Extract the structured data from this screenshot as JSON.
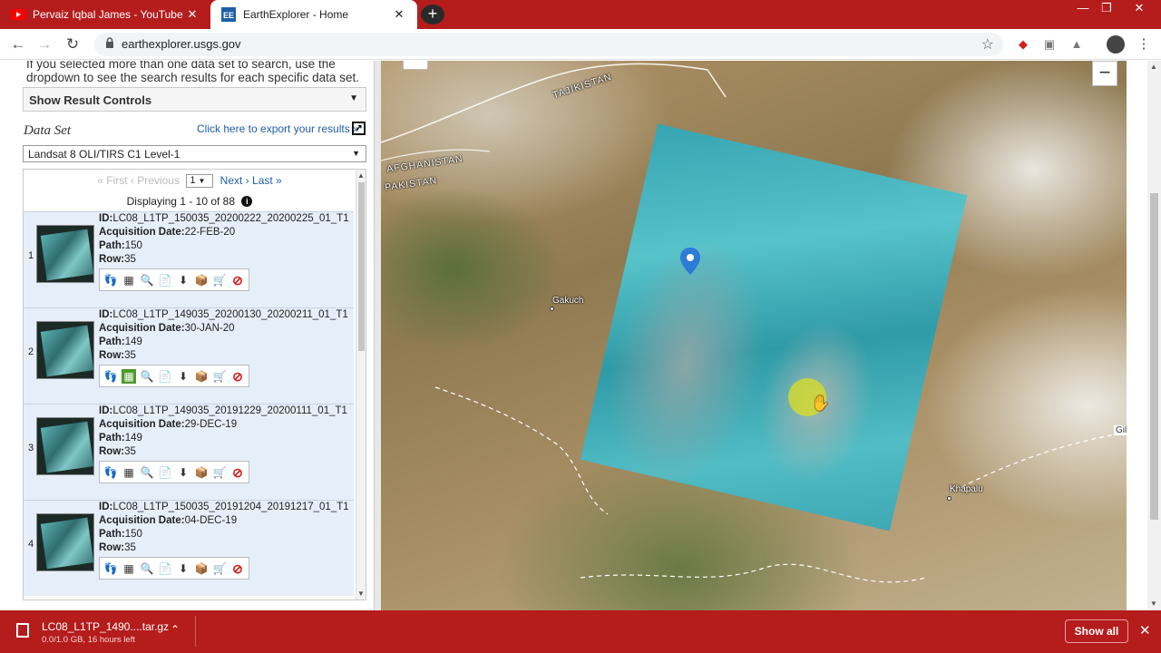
{
  "browser": {
    "tabs": [
      {
        "title": "Pervaiz Iqbal James - YouTube",
        "favicon": "youtube-icon",
        "active": false
      },
      {
        "title": "EarthExplorer - Home",
        "favicon": "earthexplorer-icon",
        "active": true
      }
    ],
    "new_tab": "+",
    "url": "earthexplorer.usgs.gov",
    "accent": "#b51c1c"
  },
  "panel": {
    "help_text": "If you selected more than one data set to search, use the dropdown to see the search results for each specific data set.",
    "result_controls_label": "Show Result Controls",
    "dataset_label": "Data Set",
    "export_link": "Click here to export your results »",
    "dataset_selected": "Landsat 8 OLI/TIRS C1 Level-1",
    "pager": {
      "first": "« First",
      "previous": "‹ Previous",
      "page": "1",
      "next": "Next ›",
      "last": "Last »"
    },
    "displaying": "Displaying 1 - 10 of 88",
    "id_prefix": "ID:",
    "acq_prefix": "Acquisition Date:",
    "path_prefix": "Path:",
    "row_prefix": "Row:",
    "results": [
      {
        "num": "1",
        "id": "LC08_L1TP_150035_20200222_20200225_01_T1",
        "date": "22-FEB-20",
        "path": "150",
        "row": "35"
      },
      {
        "num": "2",
        "id": "LC08_L1TP_149035_20200130_20200211_01_T1",
        "date": "30-JAN-20",
        "path": "149",
        "row": "35"
      },
      {
        "num": "3",
        "id": "LC08_L1TP_149035_20191229_20200111_01_T1",
        "date": "29-DEC-19",
        "path": "149",
        "row": "35"
      },
      {
        "num": "4",
        "id": "LC08_L1TP_150035_20191204_20191217_01_T1",
        "date": "04-DEC-19",
        "path": "150",
        "row": "35"
      }
    ]
  },
  "map": {
    "labels": {
      "tajikistan": "TAJIKISTAN",
      "afghanistan": "AFGHANISTAN",
      "pakistan": "PAKISTAN",
      "gakuch": "Gakuch",
      "khapalu": "Khapalu",
      "edge": "Gil"
    },
    "zoom_out": "−"
  },
  "downloads": {
    "file_name": "LC08_L1TP_1490....tar.gz",
    "status": "0.0/1.0 GB, 16 hours left",
    "show_all": "Show all"
  }
}
